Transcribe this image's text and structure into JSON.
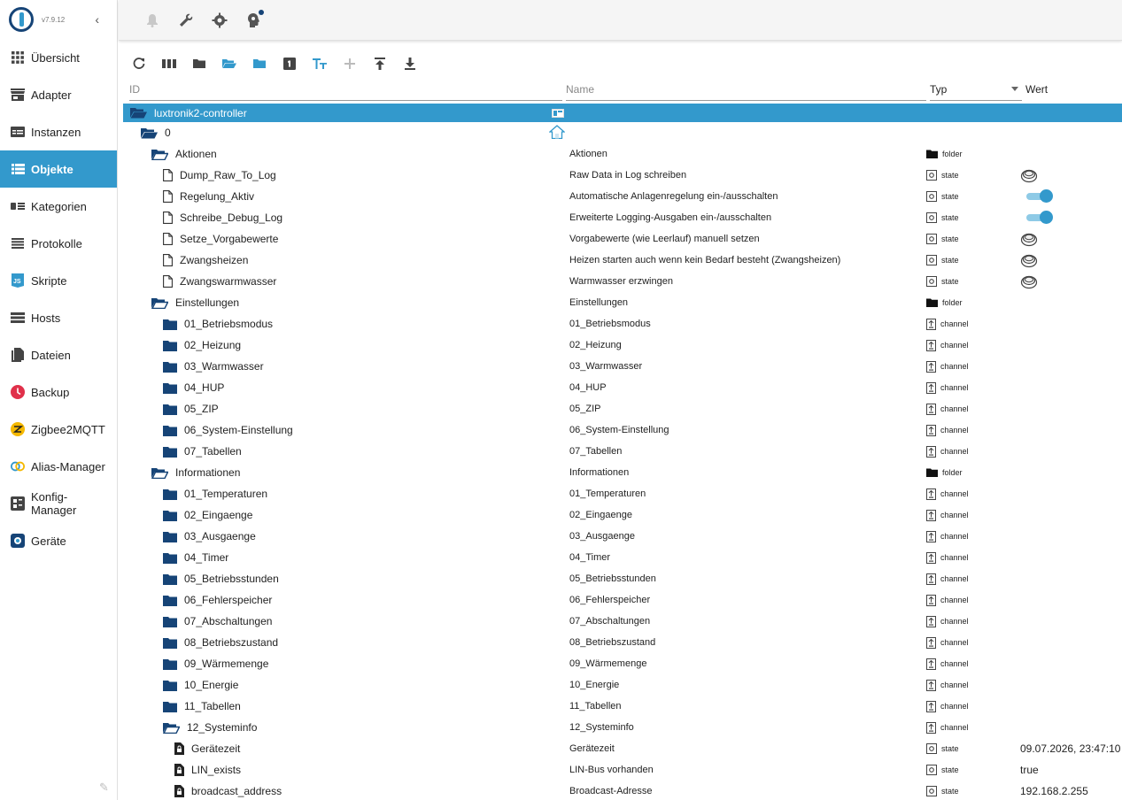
{
  "app": {
    "version": "v7.9.12"
  },
  "sidebar": {
    "items": [
      {
        "label": "Übersicht",
        "icon": "grid-icon"
      },
      {
        "label": "Adapter",
        "icon": "store-icon"
      },
      {
        "label": "Instanzen",
        "icon": "instances-icon"
      },
      {
        "label": "Objekte",
        "icon": "list-icon"
      },
      {
        "label": "Kategorien",
        "icon": "categories-icon"
      },
      {
        "label": "Protokolle",
        "icon": "log-icon"
      },
      {
        "label": "Skripte",
        "icon": "js-icon"
      },
      {
        "label": "Hosts",
        "icon": "hosts-icon"
      },
      {
        "label": "Dateien",
        "icon": "files-icon"
      },
      {
        "label": "Backup",
        "icon": "backup-icon"
      },
      {
        "label": "Zigbee2MQTT",
        "icon": "zigbee-icon"
      },
      {
        "label": "Alias-Manager",
        "icon": "alias-icon"
      },
      {
        "label": "Konfig-\nManager",
        "icon": "config-icon"
      },
      {
        "label": "Geräte",
        "icon": "devices-icon"
      }
    ]
  },
  "columns": {
    "id": "ID",
    "name": "Name",
    "typ": "Typ",
    "wert": "Wert"
  },
  "tree": [
    {
      "id": "luxtronik2-controller",
      "name": "",
      "type": "",
      "value": "",
      "level": 0,
      "kind": "folder-open",
      "selected": true,
      "nameIcon": "adapter-icon"
    },
    {
      "id": "0",
      "name": "",
      "type": "",
      "value": "",
      "level": 1,
      "kind": "folder-open",
      "nameIcon": "home-icon"
    },
    {
      "id": "Aktionen",
      "name": "Aktionen",
      "type": "folder",
      "value": "",
      "level": 2,
      "kind": "folder-open-outline"
    },
    {
      "id": "Dump_Raw_To_Log",
      "name": "Raw Data in Log schreiben",
      "type": "state",
      "value": "",
      "level": 3,
      "kind": "file",
      "control": "button"
    },
    {
      "id": "Regelung_Aktiv",
      "name": "Automatische Anlagenregelung ein-/ausschalten",
      "type": "state",
      "value": "",
      "level": 3,
      "kind": "file",
      "control": "toggle"
    },
    {
      "id": "Schreibe_Debug_Log",
      "name": "Erweiterte Logging-Ausgaben ein-/ausschalten",
      "type": "state",
      "value": "",
      "level": 3,
      "kind": "file",
      "control": "toggle"
    },
    {
      "id": "Setze_Vorgabewerte",
      "name": "Vorgabewerte (wie Leerlauf) manuell setzen",
      "type": "state",
      "value": "",
      "level": 3,
      "kind": "file",
      "control": "button"
    },
    {
      "id": "Zwangsheizen",
      "name": "Heizen starten auch wenn kein Bedarf besteht (Zwangsheizen)",
      "type": "state",
      "value": "",
      "level": 3,
      "kind": "file",
      "control": "button"
    },
    {
      "id": "Zwangswarmwasser",
      "name": "Warmwasser erzwingen",
      "type": "state",
      "value": "",
      "level": 3,
      "kind": "file",
      "control": "button"
    },
    {
      "id": "Einstellungen",
      "name": "Einstellungen",
      "type": "folder",
      "value": "",
      "level": 2,
      "kind": "folder-open-outline"
    },
    {
      "id": "01_Betriebsmodus",
      "name": "01_Betriebsmodus",
      "type": "channel",
      "value": "",
      "level": 3,
      "kind": "folder"
    },
    {
      "id": "02_Heizung",
      "name": "02_Heizung",
      "type": "channel",
      "value": "",
      "level": 3,
      "kind": "folder"
    },
    {
      "id": "03_Warmwasser",
      "name": "03_Warmwasser",
      "type": "channel",
      "value": "",
      "level": 3,
      "kind": "folder"
    },
    {
      "id": "04_HUP",
      "name": "04_HUP",
      "type": "channel",
      "value": "",
      "level": 3,
      "kind": "folder"
    },
    {
      "id": "05_ZIP",
      "name": "05_ZIP",
      "type": "channel",
      "value": "",
      "level": 3,
      "kind": "folder"
    },
    {
      "id": "06_System-Einstellung",
      "name": "06_System-Einstellung",
      "type": "channel",
      "value": "",
      "level": 3,
      "kind": "folder"
    },
    {
      "id": "07_Tabellen",
      "name": "07_Tabellen",
      "type": "channel",
      "value": "",
      "level": 3,
      "kind": "folder"
    },
    {
      "id": "Informationen",
      "name": "Informationen",
      "type": "folder",
      "value": "",
      "level": 2,
      "kind": "folder-open-outline"
    },
    {
      "id": "01_Temperaturen",
      "name": "01_Temperaturen",
      "type": "channel",
      "value": "",
      "level": 3,
      "kind": "folder"
    },
    {
      "id": "02_Eingaenge",
      "name": "02_Eingaenge",
      "type": "channel",
      "value": "",
      "level": 3,
      "kind": "folder"
    },
    {
      "id": "03_Ausgaenge",
      "name": "03_Ausgaenge",
      "type": "channel",
      "value": "",
      "level": 3,
      "kind": "folder"
    },
    {
      "id": "04_Timer",
      "name": "04_Timer",
      "type": "channel",
      "value": "",
      "level": 3,
      "kind": "folder"
    },
    {
      "id": "05_Betriebsstunden",
      "name": "05_Betriebsstunden",
      "type": "channel",
      "value": "",
      "level": 3,
      "kind": "folder"
    },
    {
      "id": "06_Fehlerspeicher",
      "name": "06_Fehlerspeicher",
      "type": "channel",
      "value": "",
      "level": 3,
      "kind": "folder"
    },
    {
      "id": "07_Abschaltungen",
      "name": "07_Abschaltungen",
      "type": "channel",
      "value": "",
      "level": 3,
      "kind": "folder"
    },
    {
      "id": "08_Betriebszustand",
      "name": "08_Betriebszustand",
      "type": "channel",
      "value": "",
      "level": 3,
      "kind": "folder"
    },
    {
      "id": "09_Wärmemenge",
      "name": "09_Wärmemenge",
      "type": "channel",
      "value": "",
      "level": 3,
      "kind": "folder"
    },
    {
      "id": "10_Energie",
      "name": "10_Energie",
      "type": "channel",
      "value": "",
      "level": 3,
      "kind": "folder"
    },
    {
      "id": "11_Tabellen",
      "name": "11_Tabellen",
      "type": "channel",
      "value": "",
      "level": 3,
      "kind": "folder"
    },
    {
      "id": "12_Systeminfo",
      "name": "12_Systeminfo",
      "type": "channel",
      "value": "",
      "level": 3,
      "kind": "folder-open-outline"
    },
    {
      "id": "Gerätezeit",
      "name": "Gerätezeit",
      "type": "state",
      "value": "09.07.2026, 23:47:10",
      "level": 4,
      "kind": "file-locked"
    },
    {
      "id": "LIN_exists",
      "name": "LIN-Bus vorhanden",
      "type": "state",
      "value": "true",
      "level": 4,
      "kind": "file-locked"
    },
    {
      "id": "broadcast_address",
      "name": "Broadcast-Adresse",
      "type": "state",
      "value": "192.168.2.255",
      "level": 4,
      "kind": "file-locked"
    }
  ],
  "colors": {
    "accent": "#3399cc",
    "folder": "#164477"
  }
}
